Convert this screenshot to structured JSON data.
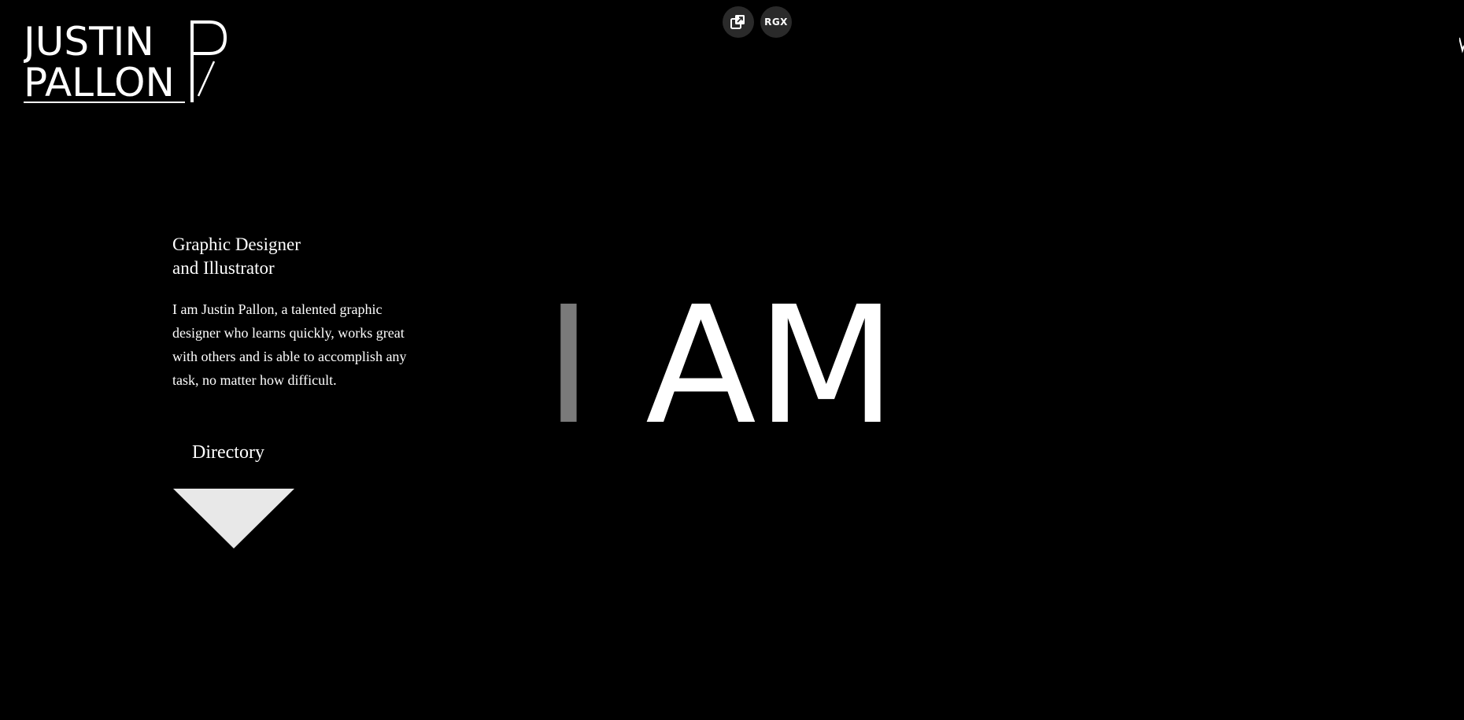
{
  "logo": {
    "line1": "JUSTIN",
    "line2": "PALLON"
  },
  "toolbar": {
    "rgx_label": "RGX",
    "icons": [
      "copy-icon"
    ]
  },
  "hero": {
    "heading_part1": "I",
    "heading_part2": "AM"
  },
  "intro": {
    "title_line1": "Graphic Designer",
    "title_line2": "and Illustrator",
    "description": "I am Justin Pallon, a talented graphic designer who learns quickly, works great with others and is able to accomplish any task, no matter how difficult."
  },
  "directory": {
    "label": "Directory"
  },
  "colors": {
    "background": "#000000",
    "text": "#ffffff",
    "faded_letter": "#7a7a7a",
    "arrow": "#e8e8e8",
    "tool_button": "#2a2a2a"
  }
}
